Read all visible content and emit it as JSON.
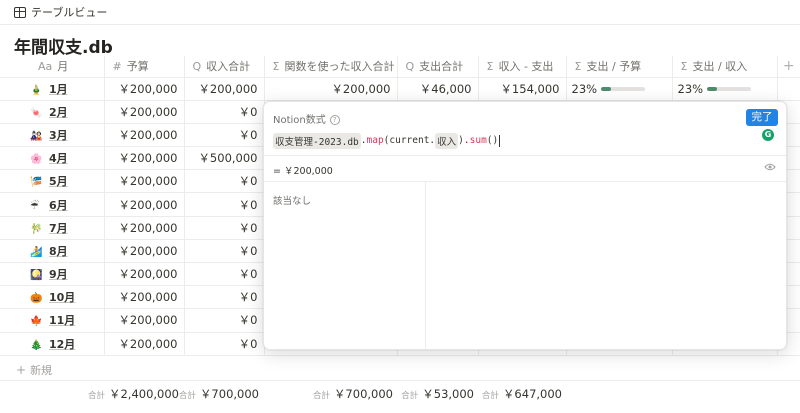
{
  "view_tab": {
    "label": "テーブルビュー",
    "icon": "table-icon"
  },
  "title": "年間収支.db",
  "columns": [
    {
      "icon": "Aa",
      "label": "月"
    },
    {
      "icon": "#",
      "label": "予算"
    },
    {
      "icon": "Q",
      "label": "収入合計"
    },
    {
      "icon": "Σ",
      "label": "関数を使った収入合計"
    },
    {
      "icon": "Q",
      "label": "支出合計"
    },
    {
      "icon": "Σ",
      "label": "収入 - 支出"
    },
    {
      "icon": "Σ",
      "label": "支出 / 予算"
    },
    {
      "icon": "Σ",
      "label": "支出 / 収入"
    },
    {
      "icon": "+",
      "label": ""
    }
  ],
  "rows": [
    {
      "emoji": "🎍",
      "month": "1月",
      "budget": "￥200,000",
      "income": "￥200,000",
      "income_fn": "￥200,000",
      "expense": "￥46,000",
      "diff": "￥154,000",
      "exp_budget": "23%",
      "exp_budget_ratio": 0.23,
      "exp_income": "23%",
      "exp_income_ratio": 0.23
    },
    {
      "emoji": "🍬",
      "month": "2月",
      "budget": "￥200,000",
      "income": "￥0"
    },
    {
      "emoji": "🎎",
      "month": "3月",
      "budget": "￥200,000",
      "income": "￥0"
    },
    {
      "emoji": "🌸",
      "month": "4月",
      "budget": "￥200,000",
      "income": "￥500,000"
    },
    {
      "emoji": "🎏",
      "month": "5月",
      "budget": "￥200,000",
      "income": "￥0"
    },
    {
      "emoji": "☔",
      "month": "6月",
      "budget": "￥200,000",
      "income": "￥0"
    },
    {
      "emoji": "🎋",
      "month": "7月",
      "budget": "￥200,000",
      "income": "￥0"
    },
    {
      "emoji": "🏄",
      "month": "8月",
      "budget": "￥200,000",
      "income": "￥0"
    },
    {
      "emoji": "🎑",
      "month": "9月",
      "budget": "￥200,000",
      "income": "￥0"
    },
    {
      "emoji": "🎃",
      "month": "10月",
      "budget": "￥200,000",
      "income": "￥0"
    },
    {
      "emoji": "🍁",
      "month": "11月",
      "budget": "￥200,000",
      "income": "￥0"
    },
    {
      "emoji": "🎄",
      "month": "12月",
      "budget": "￥200,000",
      "income": "￥0"
    }
  ],
  "new_row_label": "新規",
  "sums": {
    "label": "合計",
    "budget": "￥2,400,000",
    "income": "￥700,000",
    "income_fn": "￥700,000",
    "expense": "￥53,000",
    "diff": "￥647,000"
  },
  "formula_popup": {
    "title": "Notion数式",
    "done_label": "完了",
    "badge": "G",
    "code_ref": "収支管理-2023.db",
    "code_dot1": ".",
    "code_map": "map",
    "code_open": "(current.",
    "code_prop": "収入",
    "code_close": ").",
    "code_sum": "sum",
    "code_end": "()",
    "result_prefix": "=",
    "result_value": "￥200,000",
    "empty_label": "該当なし"
  },
  "colors": {
    "accent": "#2383e2",
    "progress": "#4e8c6d",
    "fn": "#d23b59",
    "badge": "#15a26a"
  }
}
